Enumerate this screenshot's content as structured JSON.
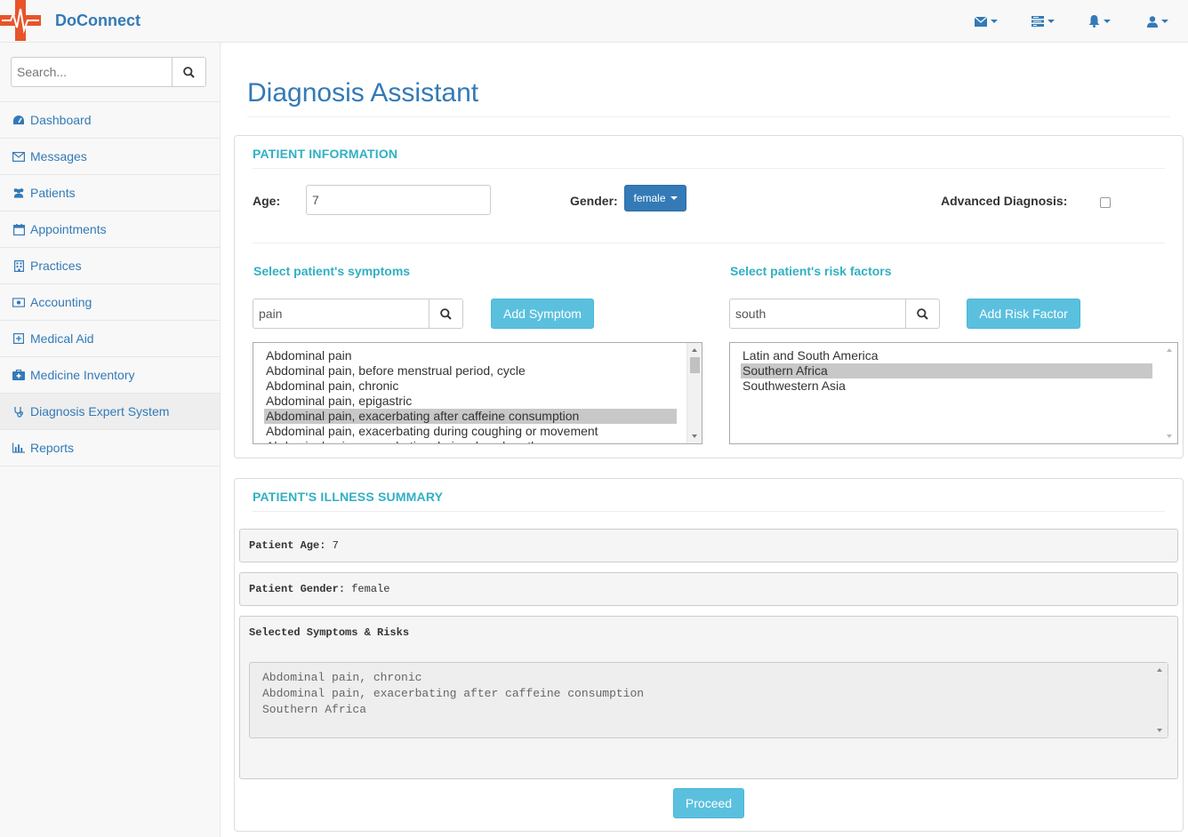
{
  "app": {
    "brand": "DoConnect"
  },
  "navbar": {
    "icons": [
      "envelope-icon",
      "tasks-icon",
      "bell-icon",
      "user-icon"
    ]
  },
  "sidebar": {
    "search_placeholder": "Search...",
    "items": [
      {
        "label": "Dashboard",
        "icon": "dashboard-icon"
      },
      {
        "label": "Messages",
        "icon": "envelope-icon"
      },
      {
        "label": "Patients",
        "icon": "users-icon"
      },
      {
        "label": "Appointments",
        "icon": "calendar-icon"
      },
      {
        "label": "Practices",
        "icon": "building-icon"
      },
      {
        "label": "Accounting",
        "icon": "money-icon"
      },
      {
        "label": "Medical Aid",
        "icon": "plus-square-icon"
      },
      {
        "label": "Medicine Inventory",
        "icon": "medkit-icon"
      },
      {
        "label": "Diagnosis Expert System",
        "icon": "stethoscope-icon"
      },
      {
        "label": "Reports",
        "icon": "bar-chart-icon"
      }
    ],
    "active_index": 8
  },
  "page": {
    "title": "Diagnosis Assistant"
  },
  "patient_info": {
    "heading": "PATIENT INFORMATION",
    "age_label": "Age:",
    "age_value": "7",
    "gender_label": "Gender:",
    "gender_value": "female",
    "advanced_label": "Advanced Diagnosis:",
    "advanced_checked": false,
    "symptoms": {
      "heading": "Select patient's symptoms",
      "search_value": "pain",
      "add_label": "Add Symptom",
      "options": [
        "Abdominal pain",
        "Abdominal pain, before menstrual period, cycle",
        "Abdominal pain, chronic",
        "Abdominal pain, epigastric",
        "Abdominal pain, exacerbating after caffeine consumption",
        "Abdominal pain, exacerbating during coughing or movement",
        "Abdominal pain, exacerbating during deep breath"
      ],
      "selected_index": 4
    },
    "risks": {
      "heading": "Select patient's risk factors",
      "search_value": "south",
      "add_label": "Add Risk Factor",
      "options": [
        "Latin and South America",
        "Southern Africa",
        "Southwestern Asia"
      ],
      "selected_index": 1
    }
  },
  "summary": {
    "heading": "PATIENT'S ILLNESS SUMMARY",
    "age_label": "Patient Age:",
    "age_value": "7",
    "gender_label": "Patient Gender:",
    "gender_value": "female",
    "selected_label": "Selected Symptoms & Risks",
    "selected_items": [
      "Abdominal pain, chronic",
      "Abdominal pain, exacerbating after caffeine consumption",
      "Southern Africa"
    ],
    "proceed_label": "Proceed"
  },
  "colors": {
    "primary": "#337ab7",
    "info": "#5bc0de",
    "heading": "#31b0c4"
  }
}
